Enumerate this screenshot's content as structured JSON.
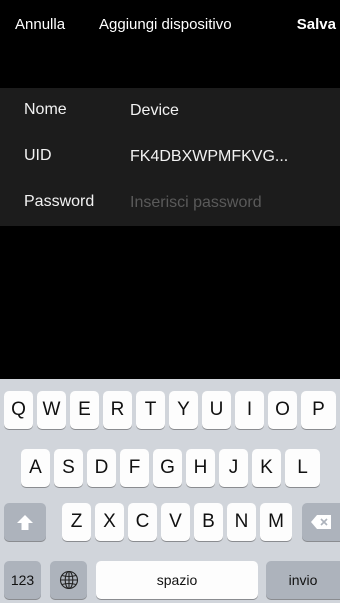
{
  "navbar": {
    "cancel_label": "Annulla",
    "title": "Aggiungi dispositivo",
    "save_label": "Salva"
  },
  "form": {
    "name": {
      "label": "Nome",
      "value": "Device"
    },
    "uid": {
      "label": "UID",
      "value": "FK4DBXWPMFKVG..."
    },
    "password": {
      "label": "Password",
      "value": "",
      "placeholder": "Inserisci password"
    }
  },
  "keyboard": {
    "row1": [
      "Q",
      "W",
      "E",
      "R",
      "T",
      "Y",
      "U",
      "I",
      "O",
      "P"
    ],
    "row2": [
      "A",
      "S",
      "D",
      "F",
      "G",
      "H",
      "J",
      "K",
      "L"
    ],
    "row3": [
      "Z",
      "X",
      "C",
      "V",
      "B",
      "N",
      "M"
    ],
    "numbers_label": "123",
    "space_label": "spazio",
    "return_label": "invio",
    "icons": {
      "shift": "shift-arrow-icon",
      "delete": "backspace-icon",
      "globe": "globe-icon"
    }
  }
}
